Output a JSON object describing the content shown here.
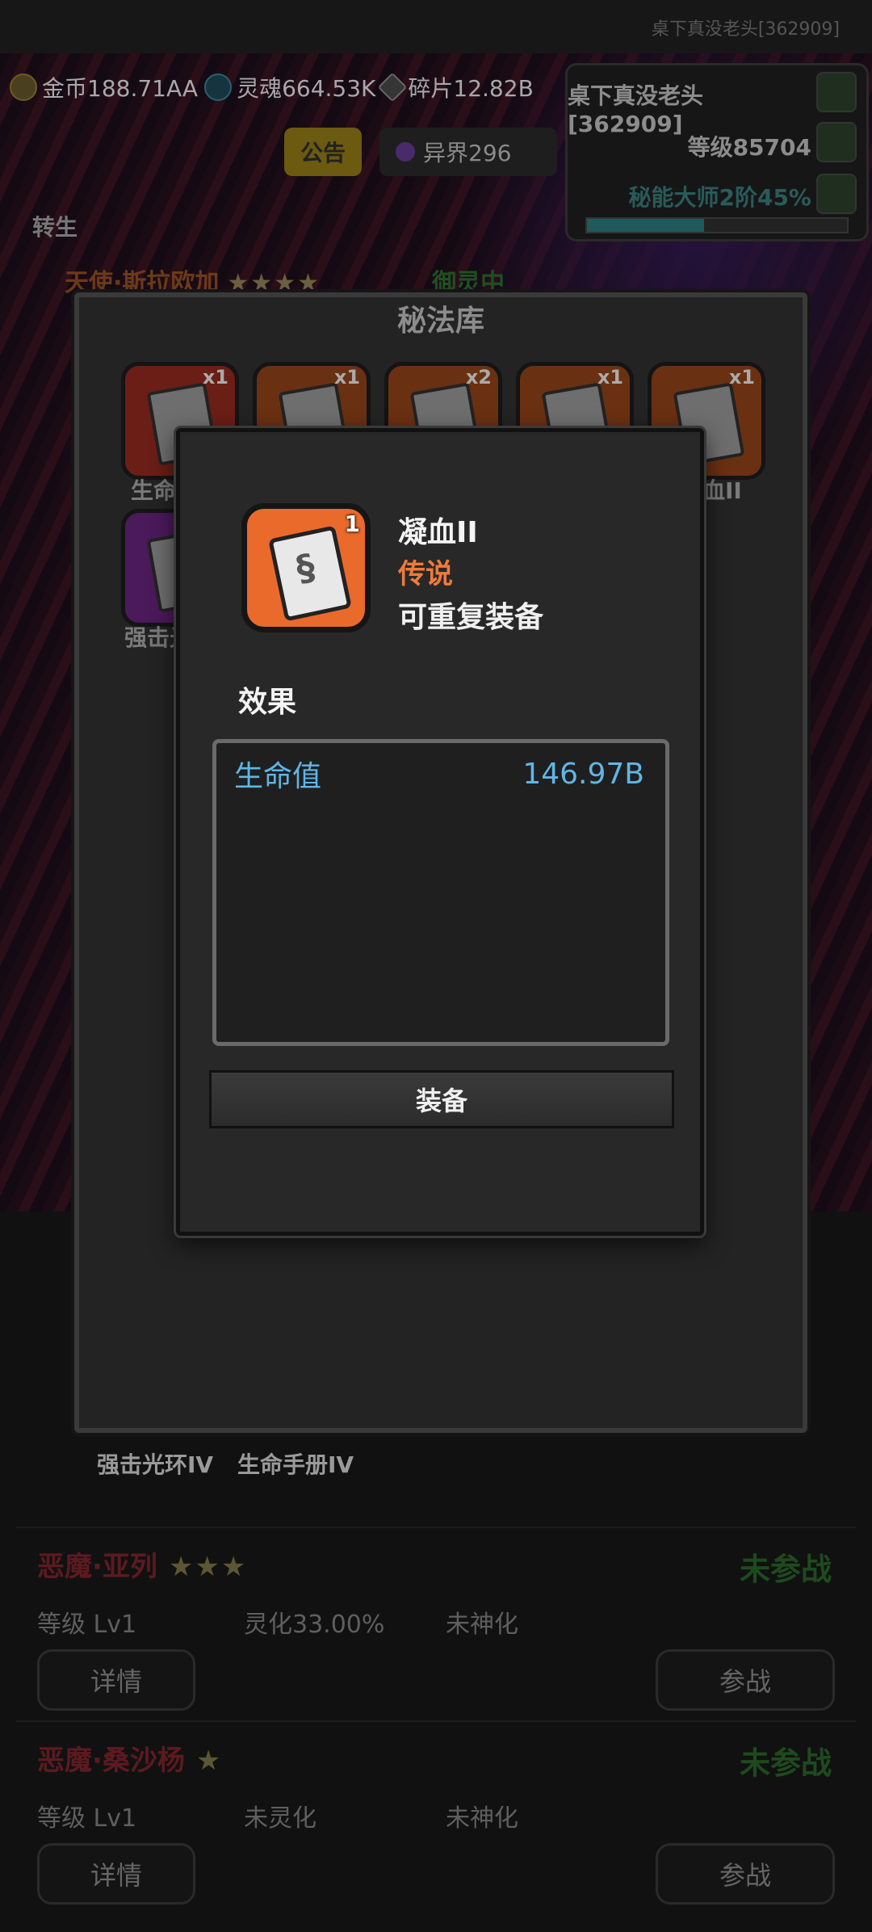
{
  "top": {
    "player_small": "桌下真没老头[362909]"
  },
  "resources": [
    {
      "label": "金币188.71AA",
      "icon": "gold-coin-icon"
    },
    {
      "label": "灵魂664.53K",
      "icon": "soul-icon"
    },
    {
      "label": "碎片12.82B",
      "icon": "shard-icon"
    }
  ],
  "notice_label": "公告",
  "realm_label": "异界296",
  "player": {
    "name": "桌下真没老头[362909]",
    "level": "等级85704",
    "rank": "秘能大师2阶45%",
    "rank_progress": 0.45
  },
  "side_left_label": "转生",
  "bg_hero": {
    "name": "天使·斯拉欧加",
    "stars": "★★★★",
    "status": "御灵中"
  },
  "library": {
    "title": "秘法库",
    "items": [
      {
        "count": "x1",
        "color": "red"
      },
      {
        "count": "x1",
        "color": "orange"
      },
      {
        "count": "x2",
        "color": "orange"
      },
      {
        "count": "x1",
        "color": "orange"
      },
      {
        "count": "x1",
        "color": "orange"
      }
    ],
    "row1_label_left": "生命",
    "row1_label_right": "血II",
    "row2_label_left": "强击光",
    "bottom_buttons": [
      "强击光环IV",
      "生命手册IV"
    ]
  },
  "detail": {
    "count": "1",
    "name": "凝血II",
    "rarity": "传说",
    "repeatable": "可重复装备",
    "effect_title": "效果",
    "effect": {
      "stat": "生命值",
      "value": "146.97B"
    },
    "equip_label": "装备"
  },
  "heroes": [
    {
      "name": "恶魔·亚列",
      "stars": "★★★",
      "status": "未参战",
      "level": "等级 Lv1",
      "spirit": "灵化33.00%",
      "deify": "未神化",
      "detail_btn": "详情",
      "battle_btn": "参战"
    },
    {
      "name": "恶魔·桑沙杨",
      "stars": "★",
      "status": "未参战",
      "level": "等级 Lv1",
      "spirit": "未灵化",
      "deify": "未神化",
      "detail_btn": "详情",
      "battle_btn": "参战"
    }
  ]
}
